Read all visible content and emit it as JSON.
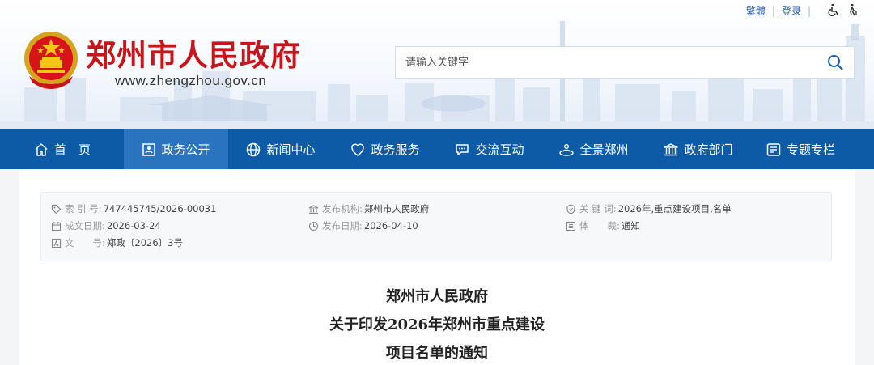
{
  "topbar": {
    "traditional_label": "繁體",
    "login_label": "登录"
  },
  "header": {
    "site_name": "郑州市人民政府",
    "site_url": "www.zhengzhou.gov.cn",
    "search_placeholder": "请输入关键字"
  },
  "nav": {
    "items": [
      {
        "label": "首　页",
        "icon": "home-icon"
      },
      {
        "label": "政务公开",
        "icon": "gov-affairs-icon"
      },
      {
        "label": "新闻中心",
        "icon": "globe-icon"
      },
      {
        "label": "政务服务",
        "icon": "heart-icon"
      },
      {
        "label": "交流互动",
        "icon": "chat-icon"
      },
      {
        "label": "全景郑州",
        "icon": "panorama-icon"
      },
      {
        "label": "政府部门",
        "icon": "building-icon"
      },
      {
        "label": "专题专栏",
        "icon": "topics-icon"
      }
    ],
    "active_index": 1
  },
  "meta": {
    "index_no": {
      "label": "索 引 号:",
      "value": "747445745/2026-00031"
    },
    "issuer": {
      "label": "发布机构:",
      "value": "郑州市人民政府"
    },
    "keywords": {
      "label": "关 键 词:",
      "value": "2026年,重点建设项目,名单"
    },
    "written_date": {
      "label": "成文日期:",
      "value": "2026-03-24"
    },
    "publish_date": {
      "label": "发布日期:",
      "value": "2026-04-10"
    },
    "genre": {
      "label": "体　　裁:",
      "value": "通知"
    },
    "doc_no": {
      "label": "文　　号:",
      "value": "郑政〔2026〕3号"
    }
  },
  "document": {
    "title_line1": "郑州市人民政府",
    "title_line2": "关于印发2026年郑州市重点建设",
    "title_line3": "项目名单的通知"
  },
  "colors": {
    "brand_red": "#c8141b",
    "nav_blue": "#0d5aa7",
    "nav_active": "#2a74bf",
    "link_blue": "#2a5db0"
  }
}
